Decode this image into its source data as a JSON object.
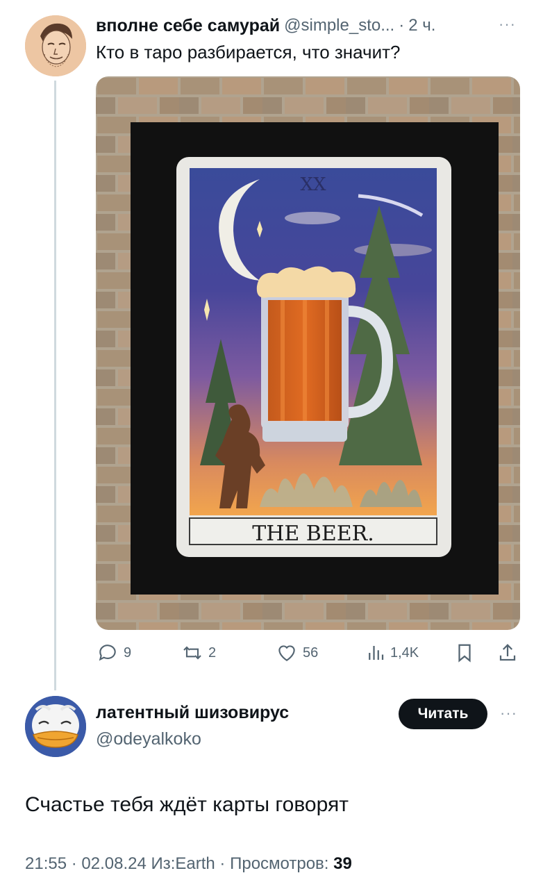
{
  "tweet": {
    "author_name": "вполне себе самурай",
    "author_handle": "@simple_sto...",
    "separator": "·",
    "time": "2 ч.",
    "more": "···",
    "text": "Кто в таро разбирается, что значит?",
    "image": {
      "card_numeral": "XX",
      "card_caption": "THE BEER."
    },
    "actions": {
      "replies": "9",
      "retweets": "2",
      "likes": "56",
      "views": "1,4K"
    }
  },
  "reply": {
    "author_name": "латентный шизовирус",
    "author_handle": "@odeyalkoko",
    "follow_label": "Читать",
    "more": "···",
    "text": "Счастье тебя ждёт карты говорят",
    "meta": {
      "time": "21:55",
      "sep1": " · ",
      "date": "02.08.24",
      "source": " Из:Earth",
      "sep2": " · ",
      "views_label": "Просмотров: ",
      "views_count": "39"
    }
  },
  "colors": {
    "text_primary": "#0f1419",
    "text_secondary": "#536471",
    "button_bg": "#0f1419",
    "divider": "#cfd9de"
  }
}
